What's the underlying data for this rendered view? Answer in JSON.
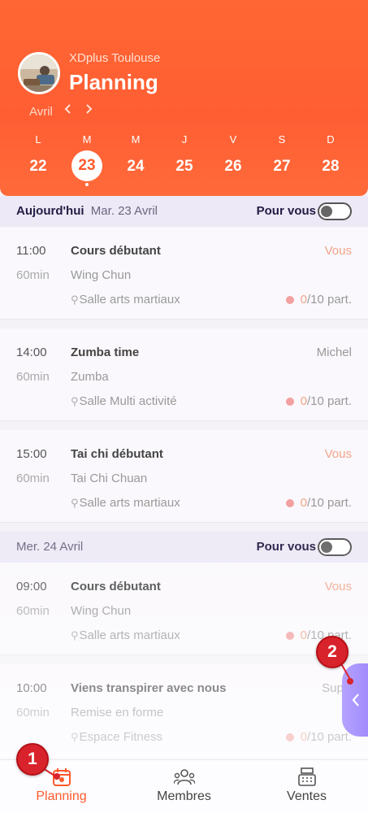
{
  "header": {
    "club_name": "XDplus Toulouse",
    "title": "Planning",
    "month": "Avril",
    "prev_icon": "chevron-left-icon",
    "next_icon": "chevron-right-icon",
    "weekdays": [
      "L",
      "M",
      "M",
      "J",
      "V",
      "S",
      "D"
    ],
    "dates": [
      "22",
      "23",
      "24",
      "25",
      "26",
      "27",
      "28"
    ],
    "selected_index": 1
  },
  "sections": [
    {
      "today_label": "Aujourd'hui",
      "date_label": "Mar. 23 Avril",
      "pour_vous": "Pour vous",
      "sessions": [
        {
          "time": "11:00",
          "duration": "60min",
          "name": "Cours débutant",
          "activity": "Wing Chun",
          "room": "Salle arts martiaux",
          "coach": "Vous",
          "count": "0",
          "capacity": "/10 part."
        },
        {
          "time": "14:00",
          "duration": "60min",
          "name": "Zumba time",
          "activity": "Zumba",
          "room": "Salle Multi activité",
          "coach": "Michel",
          "count": "0",
          "capacity": "/10 part."
        },
        {
          "time": "15:00",
          "duration": "60min",
          "name": "Tai chi débutant",
          "activity": "Tai Chi Chuan",
          "room": "Salle arts martiaux",
          "coach": "Vous",
          "count": "0",
          "capacity": "/10 part."
        }
      ]
    },
    {
      "date_label": "Mer. 24 Avril",
      "pour_vous": "Pour vous",
      "sessions": [
        {
          "time": "09:00",
          "duration": "60min",
          "name": "Cours débutant",
          "activity": "Wing Chun",
          "room": "Salle arts martiaux",
          "coach": "Vous",
          "count": "0",
          "capacity": "/10 part."
        },
        {
          "time": "10:00",
          "duration": "60min",
          "name": "Viens transpirer avec nous",
          "activity": "Remise en forme",
          "room": "Espace Fitness",
          "coach": "Superma",
          "count": "0",
          "capacity": "/10 part."
        }
      ]
    }
  ],
  "annotations": [
    "1",
    "2"
  ],
  "bottom_nav": [
    {
      "label": "Planning",
      "icon": "calendar-icon",
      "active": true
    },
    {
      "label": "Membres",
      "icon": "members-icon",
      "active": false
    },
    {
      "label": "Ventes",
      "icon": "cash-register-icon",
      "active": false
    }
  ],
  "colors": {
    "accent": "#ff5a2c",
    "side_tab": "#a48ffc",
    "annotation": "#d9232c"
  }
}
